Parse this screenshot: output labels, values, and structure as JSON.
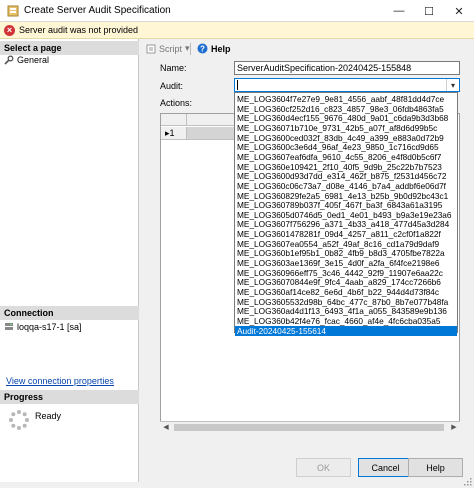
{
  "window": {
    "title": "Create Server Audit Specification",
    "minimize_glyph": "—",
    "maximize_glyph": "☐",
    "close_glyph": "✕"
  },
  "error_bar": {
    "message": "Server audit was not provided",
    "icon": "error-icon"
  },
  "left_pane": {
    "select_page_header": "Select a page",
    "pages": [
      {
        "label": "General",
        "icon": "wrench-icon"
      }
    ],
    "connection_header": "Connection",
    "connection_label": "loqqa-s17-1 [sa]",
    "view_connection_link": "View connection properties",
    "progress_header": "Progress",
    "progress_status": "Ready"
  },
  "toolbar": {
    "script_label": "Script",
    "script_dropdown_glyph": "▾",
    "help_label": "Help"
  },
  "form": {
    "name_label": "Name:",
    "name_value": "ServerAuditSpecification-20240425-155848",
    "audit_label": "Audit:",
    "audit_value": "",
    "actions_label": "Actions:"
  },
  "grid": {
    "row_marker": "▸1"
  },
  "audit_options": [
    "ME_LOG3604f7e27e9_9e81_4556_aabf_48f81dd4d7ce",
    "ME_LOG360cf252d16_c823_4857_98e3_06fdb4863fa5",
    "ME_LOG360d4ecf155_9676_480d_9a01_c6da9b3d3b68",
    "ME_LOG36071b710e_9731_42b5_a07f_af8d6d99b5c",
    "ME_LOG3600ced032f_83db_4c49_a399_e883a0d72b9",
    "ME_LOG3600c3e6d4_96af_4e23_9850_1c716cd9d65",
    "ME_LOG3607eaf6dfa_9610_4c55_8206_e4f8d0b5c6f7",
    "ME_LOG360e109421_2f10_40f5_9d9b_25c22b7b7523",
    "ME_LOG3600d93d7dd_e314_462f_b875_f2531d456c72",
    "ME_LOG360c06c73a7_d08e_4146_b7a4_addbf6e06d7f",
    "ME_LOG360829fe2a5_6981_4e13_b25b_9b0d92bc43c1",
    "ME_LOG360789b037f_405f_467f_ba3f_6843a61a3195",
    "ME_LOG3605d0746d5_0ed1_4e01_b493_b9a3e19e23a6",
    "ME_LOG3607f756296_a371_4b33_a418_477d45a3d284",
    "ME_LOG3601478281f_09d4_4257_a811_c2cf0f1a822f",
    "ME_LOG3607ea0554_a52f_49af_8c16_cd1a79d9daf9",
    "ME_LOG360b1ef95b1_0b82_4fb9_b8d3_4705fbe7822a",
    "ME_LOG3603ae1369f_3e15_4d0f_a2fa_6f4fce2198e6",
    "ME_LOG360966eff75_3c46_4442_92f9_11907e6aa22c",
    "ME_LOG36070844e9f_9fc4_4aab_a829_174cc7266b6",
    "ME_LOG360af14ce82_6e6d_4b6f_b22_944d4d73f84c",
    "ME_LOG3605532d98b_64bc_477c_87b0_8b7e077b48fa",
    "ME_LOG360ad4d1f13_6493_4f1a_a055_843589e9b136",
    "ME_LOG360b42f4e76_fcac_4660_af4e_4fc6cba035a5"
  ],
  "audit_selected": "Audit-20240425-155614",
  "buttons": {
    "ok_label": "OK",
    "cancel_label": "Cancel",
    "help_label": "Help"
  },
  "colors": {
    "selection": "#0078d7",
    "error_bar_bg": "#fff6d6",
    "error_icon": "#d13438",
    "link": "#0645ad"
  }
}
